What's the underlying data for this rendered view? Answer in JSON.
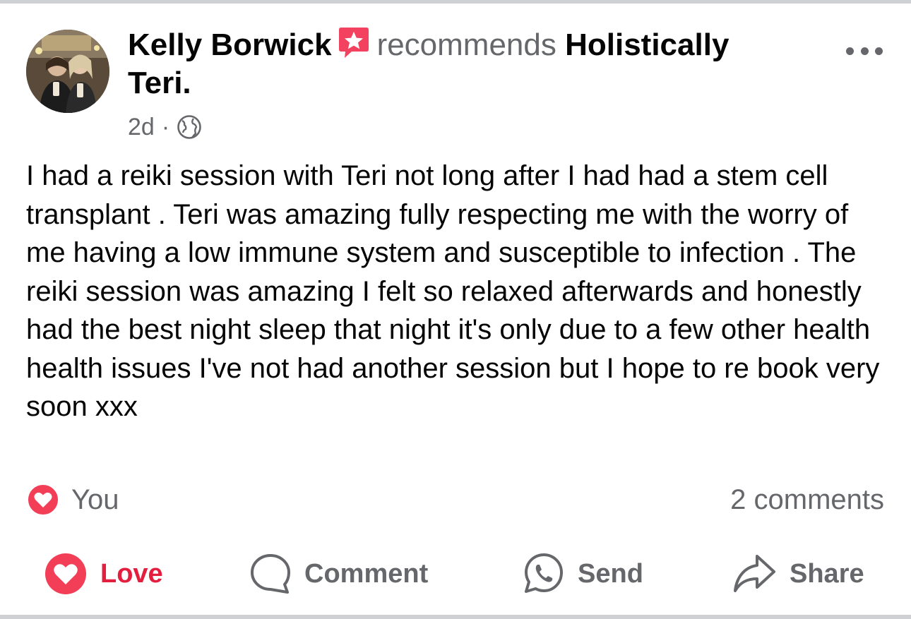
{
  "post": {
    "author": "Kelly Borwick",
    "action_text": "recommends",
    "page_name_line1": "Holistically",
    "page_name_line2": "Teri.",
    "time": "2d",
    "separator": "·",
    "audience_icon": "globe-icon",
    "body": "I had a reiki session with Teri not long after I had had a stem cell transplant . Teri was amazing fully respecting me with the worry of me having a low immune system and susceptible to infection . The reiki session was amazing I felt so relaxed afterwards and honestly had the best night sleep that night it's only due to a few other health health issues I've not had another session but I hope to re book very soon xxx"
  },
  "reactions": {
    "summary_label": "You",
    "comments_count": "2 comments"
  },
  "actions": {
    "love": "Love",
    "comment": "Comment",
    "send": "Send",
    "share": "Share"
  },
  "colors": {
    "love_red": "#e41e3f",
    "secondary_text": "#65676b",
    "recommend_badge": "#f3425f",
    "divider": "#ced0d4"
  }
}
